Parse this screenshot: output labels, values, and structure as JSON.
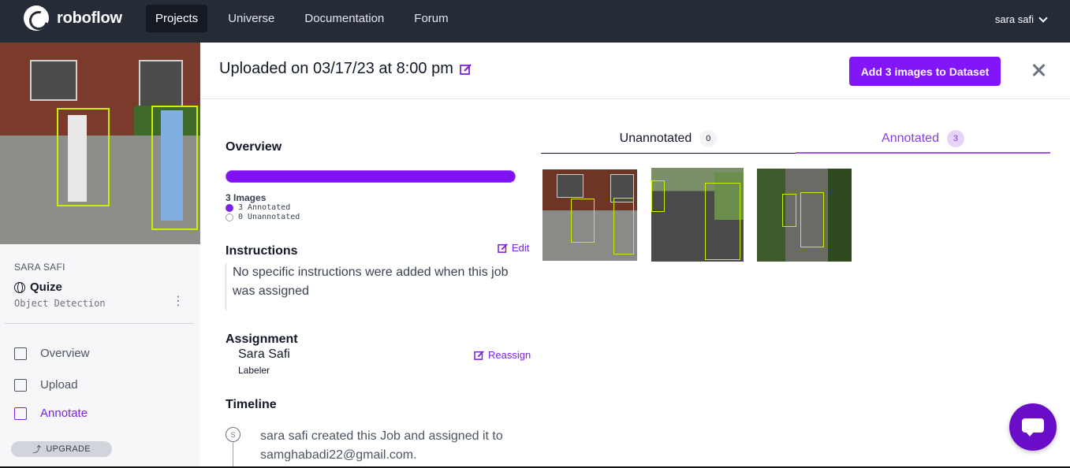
{
  "app": {
    "name": "roboflow"
  },
  "nav": {
    "links": [
      "Projects",
      "Universe",
      "Documentation",
      "Forum"
    ],
    "active": "Projects",
    "user": "sara safi"
  },
  "sidebar": {
    "owner": "SARA SAFI",
    "project_name": "Quize",
    "project_type": "Object Detection",
    "items": [
      {
        "label": "Overview",
        "icon": "document-icon"
      },
      {
        "label": "Upload",
        "icon": "upload-icon"
      },
      {
        "label": "Annotate",
        "icon": "annotate-icon",
        "active": true
      }
    ],
    "upgrade_label": "UPGRADE"
  },
  "header": {
    "title": "Uploaded on 03/17/23 at 8:00 pm",
    "add_button": "Add 3 images to Dataset"
  },
  "overview": {
    "title": "Overview",
    "progress": 1.0,
    "images_label": "3 Images",
    "annotated_label": "3 Annotated",
    "unannotated_label": "0 Unannotated"
  },
  "instructions": {
    "title": "Instructions",
    "edit_label": "Edit",
    "text": "No specific instructions were added when this job was assigned"
  },
  "assignment": {
    "title": "Assignment",
    "reassign_label": "Reassign",
    "name": "Sara Safi",
    "role": "Labeler"
  },
  "timeline": {
    "title": "Timeline",
    "marker": "S",
    "entry": "sara safi created this Job and assigned it to samghabadi22@gmail.com."
  },
  "tabs": {
    "unannotated": {
      "label": "Unannotated",
      "count": "0"
    },
    "annotated": {
      "label": "Annotated",
      "count": "3",
      "active": true
    }
  },
  "colors": {
    "accent": "#8315f9",
    "nav_bg": "#252c38",
    "bbox": "#c9f000"
  }
}
